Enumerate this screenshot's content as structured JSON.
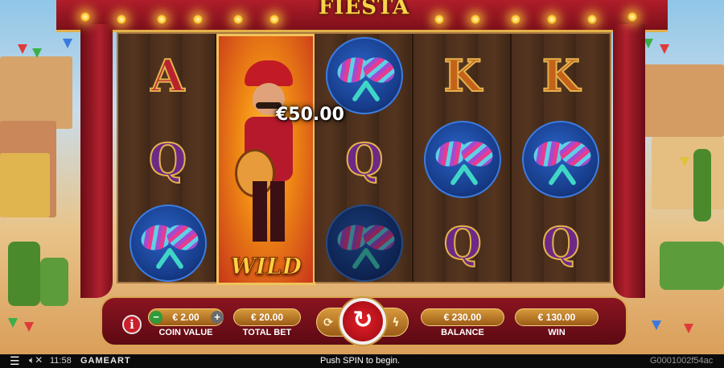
{
  "game": {
    "logo_text": "FIESTA",
    "win_amount": "€50.00",
    "reels": [
      [
        "A",
        "Q",
        "maraca"
      ],
      [
        "wild"
      ],
      [
        "maraca",
        "Q",
        "maraca"
      ],
      [
        "K",
        "maraca",
        "Q"
      ],
      [
        "K",
        "maraca",
        "Q"
      ]
    ],
    "wild_label": "WILD"
  },
  "controls": {
    "info_label": "i",
    "coin_value": "€ 2.00",
    "coin_value_label": "COIN VALUE",
    "minus_label": "−",
    "plus_label": "+",
    "total_bet": "€ 20.00",
    "total_bet_label": "TOTAL BET",
    "balance": "€ 230.00",
    "balance_label": "BALANCE",
    "win": "€ 130.00",
    "win_label": "WIN",
    "autoplay_icon": "autoplay-icon",
    "spin_icon": "spin-arrow-icon",
    "turbo_icon": "lightning-icon"
  },
  "statusbar": {
    "menu_icon": "hamburger-menu-icon",
    "sound_icon": "speaker-muted-icon",
    "time": "11:58",
    "provider": "GAMEART",
    "message": "Push SPIN to begin.",
    "game_id": "G0001002f54ac"
  },
  "colors": {
    "curtain": "#b01e2a",
    "gold": "#e0b04a",
    "spin": "#e32027"
  }
}
